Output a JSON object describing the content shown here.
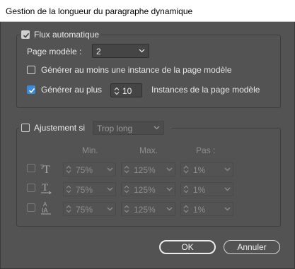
{
  "window": {
    "title": "Gestion de la longueur du paragraphe dynamique"
  },
  "flux": {
    "label": "Flux automatique",
    "checked": true,
    "page_modele_label": "Page modèle :",
    "page_modele_value": "2",
    "generer_min_label": "Générer au moins une instance de la page modèle",
    "generer_min_checked": false,
    "generer_max_label": "Générer au plus",
    "generer_max_checked": true,
    "generer_max_value": "10",
    "instances_label": "Instances de la page modèle"
  },
  "ajustement": {
    "label": "Ajustement si",
    "checked": false,
    "condition_value": "Trop long",
    "col_min": "Min.",
    "col_max": "Max.",
    "col_pas": "Pas :",
    "rows": [
      {
        "icon": "text-scale-icon",
        "min": "75%",
        "max": "125%",
        "pas": "1%"
      },
      {
        "icon": "text-horizontal-scale-icon",
        "min": "75%",
        "max": "125%",
        "pas": "1%"
      },
      {
        "icon": "tracking-icon",
        "min": "75%",
        "max": "125%",
        "pas": "1%"
      }
    ]
  },
  "buttons": {
    "ok": "OK",
    "cancel": "Annuler"
  },
  "colors": {
    "accent": "#3d8bd8",
    "background": "#535353"
  }
}
